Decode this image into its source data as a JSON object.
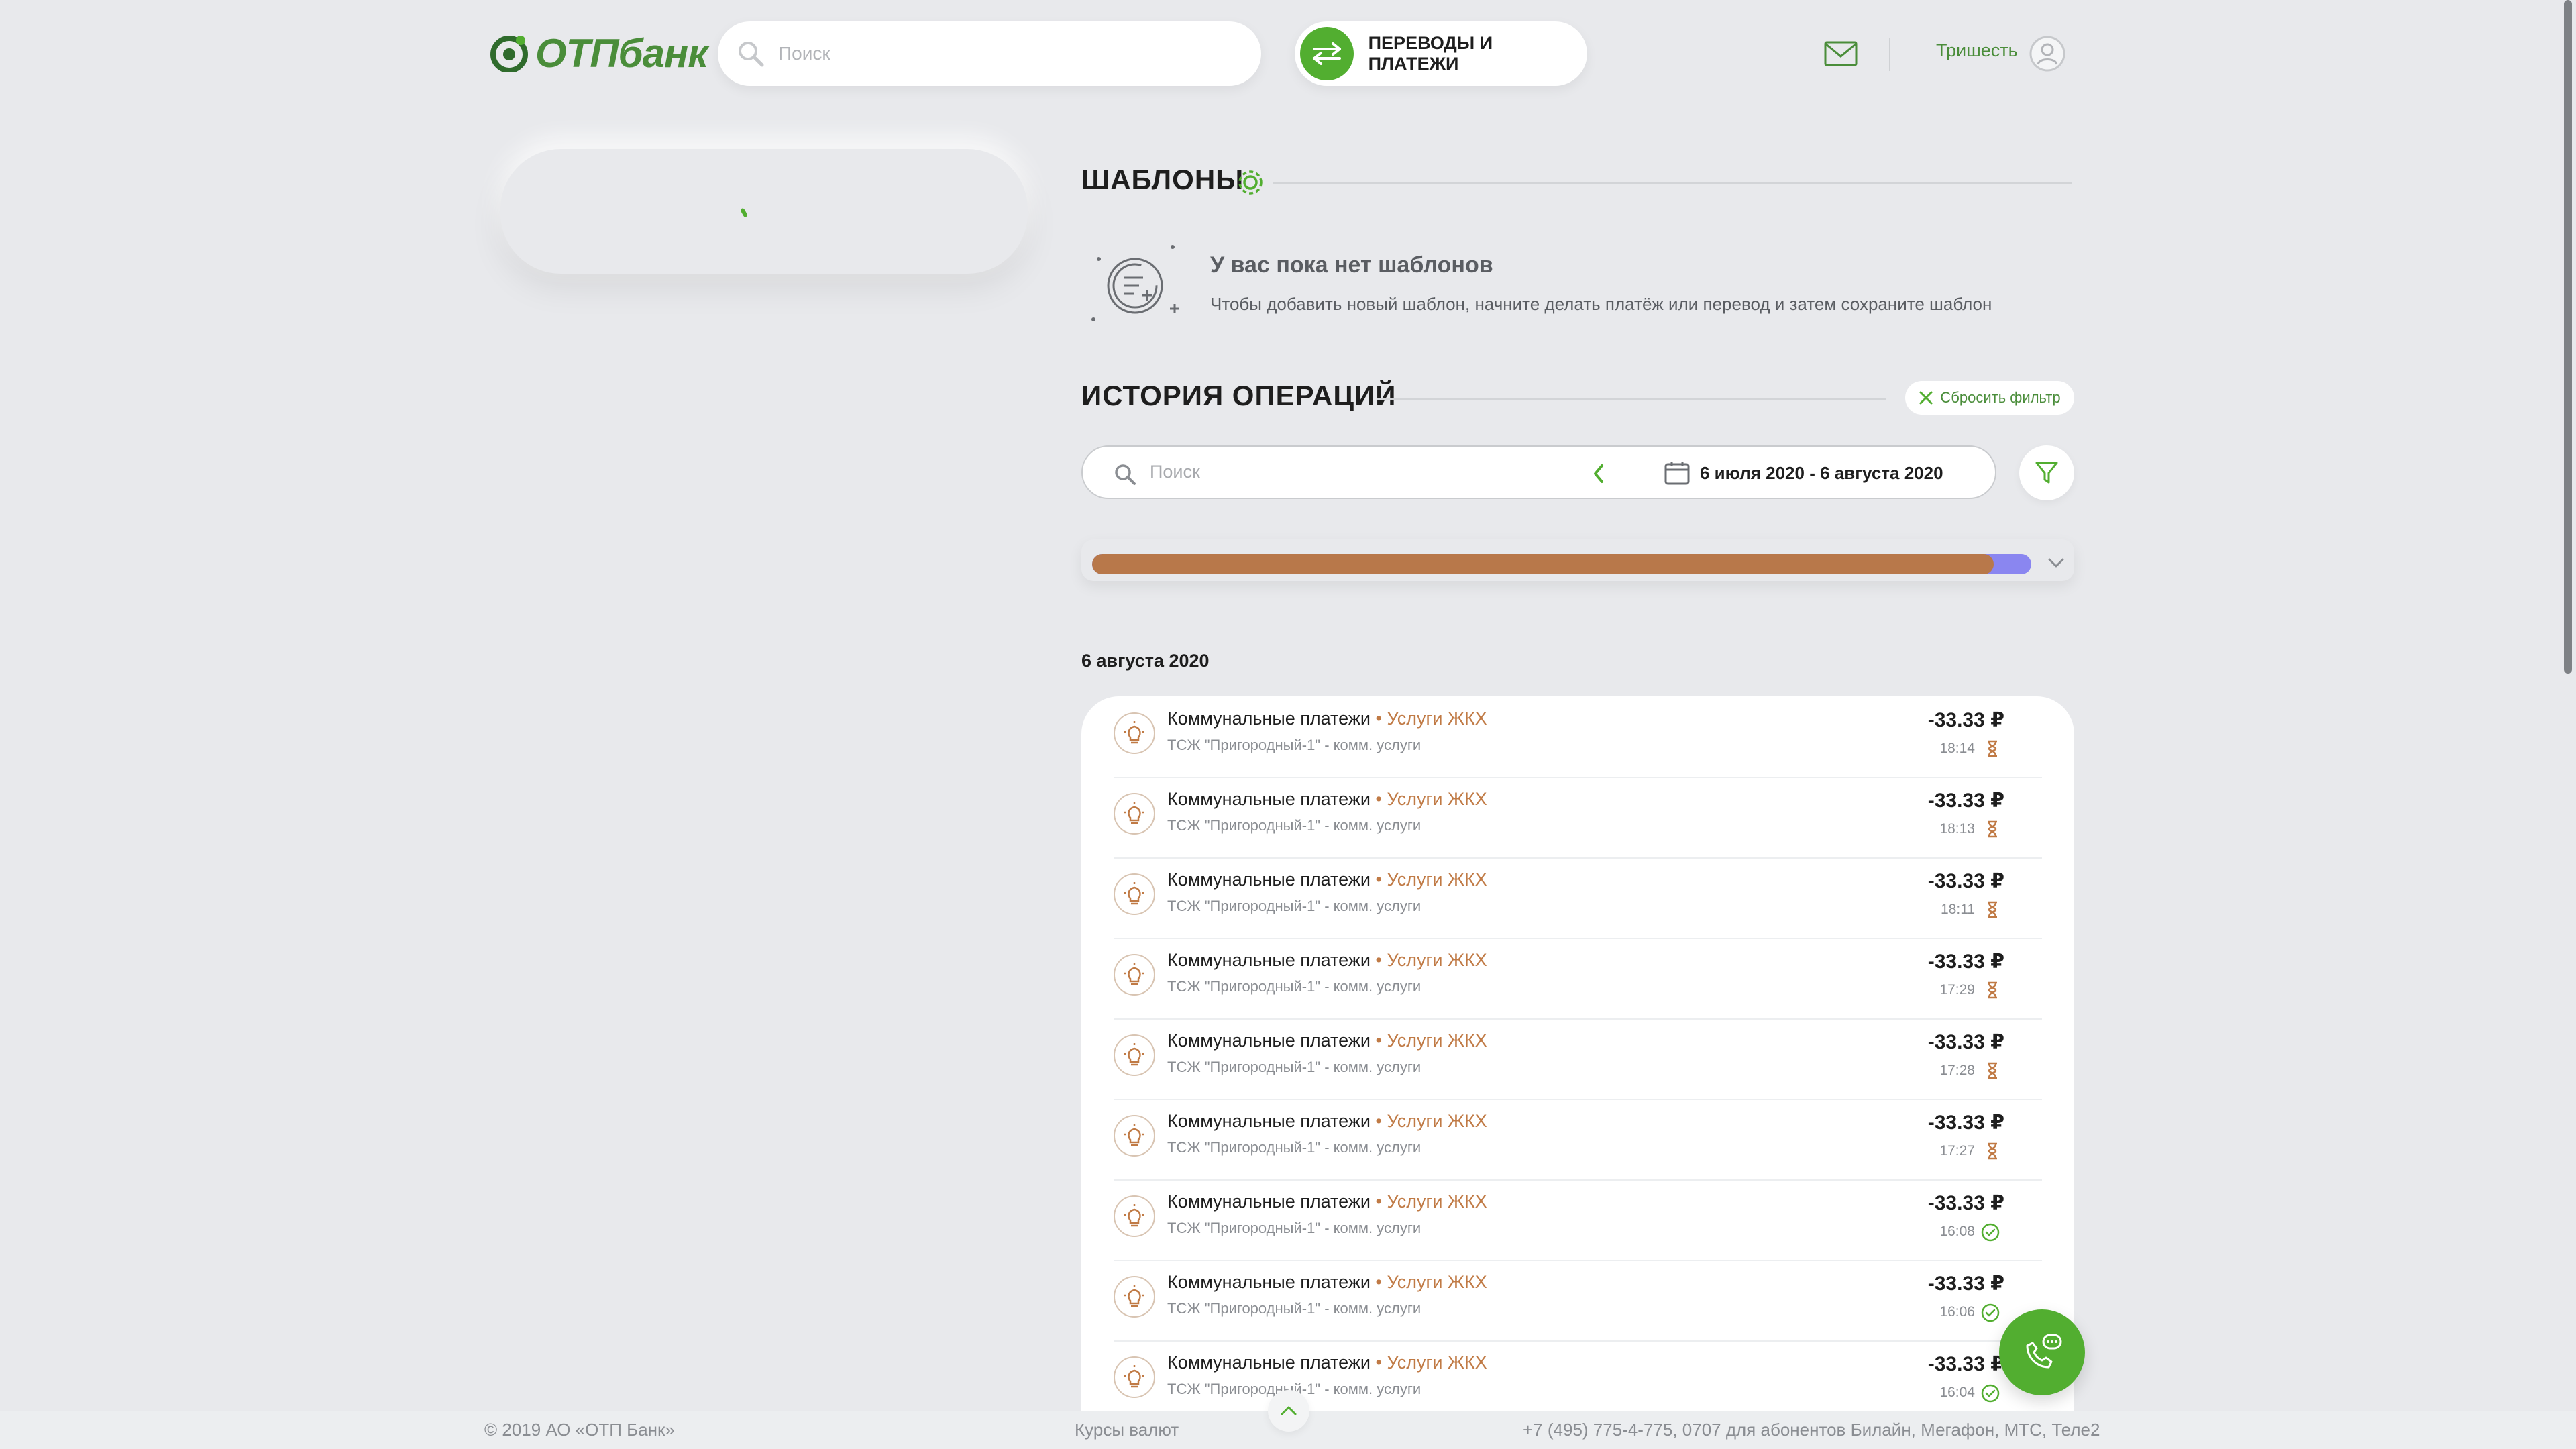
{
  "header": {
    "logo_text": "ОТПбанк",
    "search_placeholder": "Поиск",
    "transfers_label": "ПЕРЕВОДЫ И ПЛАТЕЖИ",
    "user_name": "Тришесть"
  },
  "templates": {
    "title": "ШАБЛОНЫ",
    "empty_title": "У вас пока нет шаблонов",
    "empty_desc": "Чтобы добавить новый шаблон, начните делать платёж или перевод и затем сохраните шаблон"
  },
  "history": {
    "title": "ИСТОРИЯ ОПЕРАЦИЙ",
    "reset_filter": "Сбросить фильтр",
    "search_placeholder": "Поиск",
    "date_range": "6 июля 2020 - 6 августа 2020",
    "spend_bar": {
      "fill_fraction": 0.96,
      "fill_color": "#b8784a",
      "rest_color": "#8a86f0"
    },
    "date_group": "6 августа 2020",
    "operations": [
      {
        "title": "Коммунальные платежи",
        "category": "Услуги ЖКХ",
        "desc": "ТСЖ \"Пригородный-1\" - комм. услуги",
        "amount": "-33.33 ₽",
        "time": "18:14",
        "status": "pending"
      },
      {
        "title": "Коммунальные платежи",
        "category": "Услуги ЖКХ",
        "desc": "ТСЖ \"Пригородный-1\" - комм. услуги",
        "amount": "-33.33 ₽",
        "time": "18:13",
        "status": "pending"
      },
      {
        "title": "Коммунальные платежи",
        "category": "Услуги ЖКХ",
        "desc": "ТСЖ \"Пригородный-1\" - комм. услуги",
        "amount": "-33.33 ₽",
        "time": "18:11",
        "status": "pending"
      },
      {
        "title": "Коммунальные платежи",
        "category": "Услуги ЖКХ",
        "desc": "ТСЖ \"Пригородный-1\" - комм. услуги",
        "amount": "-33.33 ₽",
        "time": "17:29",
        "status": "pending"
      },
      {
        "title": "Коммунальные платежи",
        "category": "Услуги ЖКХ",
        "desc": "ТСЖ \"Пригородный-1\" - комм. услуги",
        "amount": "-33.33 ₽",
        "time": "17:28",
        "status": "pending"
      },
      {
        "title": "Коммунальные платежи",
        "category": "Услуги ЖКХ",
        "desc": "ТСЖ \"Пригородный-1\" - комм. услуги",
        "amount": "-33.33 ₽",
        "time": "17:27",
        "status": "pending"
      },
      {
        "title": "Коммунальные платежи",
        "category": "Услуги ЖКХ",
        "desc": "ТСЖ \"Пригородный-1\" - комм. услуги",
        "amount": "-33.33 ₽",
        "time": "16:08",
        "status": "done"
      },
      {
        "title": "Коммунальные платежи",
        "category": "Услуги ЖКХ",
        "desc": "ТСЖ \"Пригородный-1\" - комм. услуги",
        "amount": "-33.33 ₽",
        "time": "16:06",
        "status": "done"
      },
      {
        "title": "Коммунальные платежи",
        "category": "Услуги ЖКХ",
        "desc": "ТСЖ \"Пригородный-1\" - комм. услуги",
        "amount": "-33.33 ₽",
        "time": "16:04",
        "status": "done"
      }
    ]
  },
  "footer": {
    "copyright": "© 2019 АО «ОТП Банк»",
    "rates": "Курсы валют",
    "phones": "+7 (495) 775-4-775,  0707 для абонентов Билайн, Мегафон, МТС, Теле2"
  },
  "colors": {
    "brand_green": "#52ae30",
    "accent_brown": "#c07a45",
    "background": "#e8e9ec"
  }
}
